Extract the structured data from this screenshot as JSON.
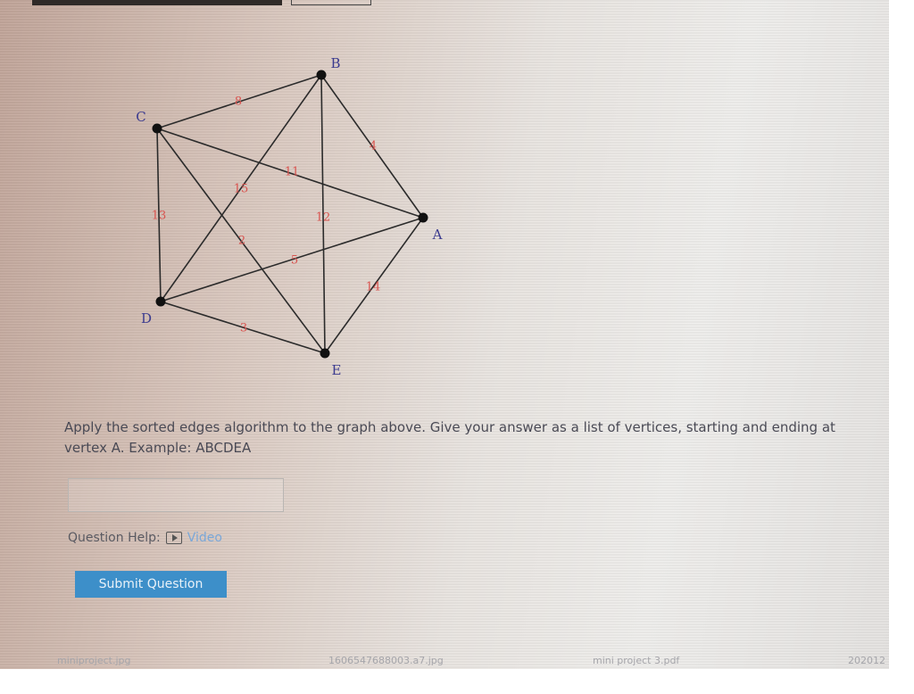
{
  "graph": {
    "vertices": [
      {
        "id": "A",
        "label": "A"
      },
      {
        "id": "B",
        "label": "B"
      },
      {
        "id": "C",
        "label": "C"
      },
      {
        "id": "D",
        "label": "D"
      },
      {
        "id": "E",
        "label": "E"
      }
    ],
    "edges": [
      {
        "from": "C",
        "to": "B",
        "weight": "8"
      },
      {
        "from": "B",
        "to": "A",
        "weight": "4"
      },
      {
        "from": "C",
        "to": "A",
        "weight": "11"
      },
      {
        "from": "B",
        "to": "D",
        "weight": "15"
      },
      {
        "from": "B",
        "to": "E",
        "weight": "12"
      },
      {
        "from": "C",
        "to": "D",
        "weight": "13"
      },
      {
        "from": "C",
        "to": "E",
        "weight": "2"
      },
      {
        "from": "D",
        "to": "A",
        "weight": "5"
      },
      {
        "from": "A",
        "to": "E",
        "weight": "14"
      },
      {
        "from": "D",
        "to": "E",
        "weight": "3"
      }
    ],
    "colors": {
      "edge": "#2b2b2b",
      "weight": "#d9534f",
      "vertex_label": "#3b3b8f"
    }
  },
  "question": {
    "text": "Apply the sorted edges algorithm to the graph above. Give your answer as a list of vertices, starting and ending at vertex A. Example: ABCDEA"
  },
  "answer": {
    "value": "",
    "placeholder": ""
  },
  "help": {
    "label": "Question Help:",
    "video_label": "Video"
  },
  "submit": {
    "label": "Submit Question"
  },
  "taskbar": {
    "items": [
      "miniproject.jpg",
      "1606547688003.a7.jpg",
      "mini project 3.pdf",
      "202012"
    ]
  }
}
